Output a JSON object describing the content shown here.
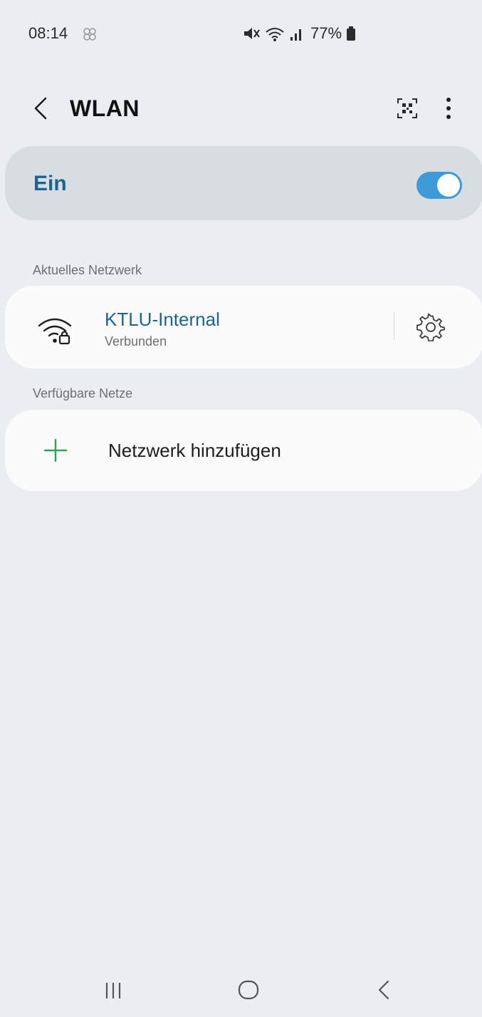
{
  "status_bar": {
    "time": "08:14",
    "battery_percent": "77%",
    "icons": [
      "notification-pinwheel-icon",
      "mute-icon",
      "wifi-status-icon",
      "cell-signal-icon",
      "battery-icon"
    ]
  },
  "header": {
    "title": "WLAN",
    "icons": [
      "back-chevron-icon",
      "qr-scan-icon",
      "more-vertical-icon"
    ]
  },
  "wifi_toggle": {
    "label": "Ein",
    "state": "on",
    "accent": "#3d9bd8"
  },
  "current_network": {
    "section_label": "Aktuelles Netzwerk",
    "name": "KTLU-Internal",
    "status": "Verbunden",
    "icons": [
      "wifi-secured-icon",
      "settings-gear-icon"
    ]
  },
  "available_networks": {
    "section_label": "Verfügbare Netze",
    "add_label": "Netzwerk hinzufügen",
    "add_icon": "plus-icon",
    "add_icon_color": "#2fa354"
  },
  "navbar": {
    "icons": [
      "recent-apps-icon",
      "home-icon",
      "nav-back-icon"
    ]
  },
  "colors": {
    "background": "#eaeef2",
    "card": "#fbfbfc",
    "toggle_card": "#d8dde2",
    "title_blue": "#1b6593",
    "secondary_text": "#6d6f72"
  }
}
